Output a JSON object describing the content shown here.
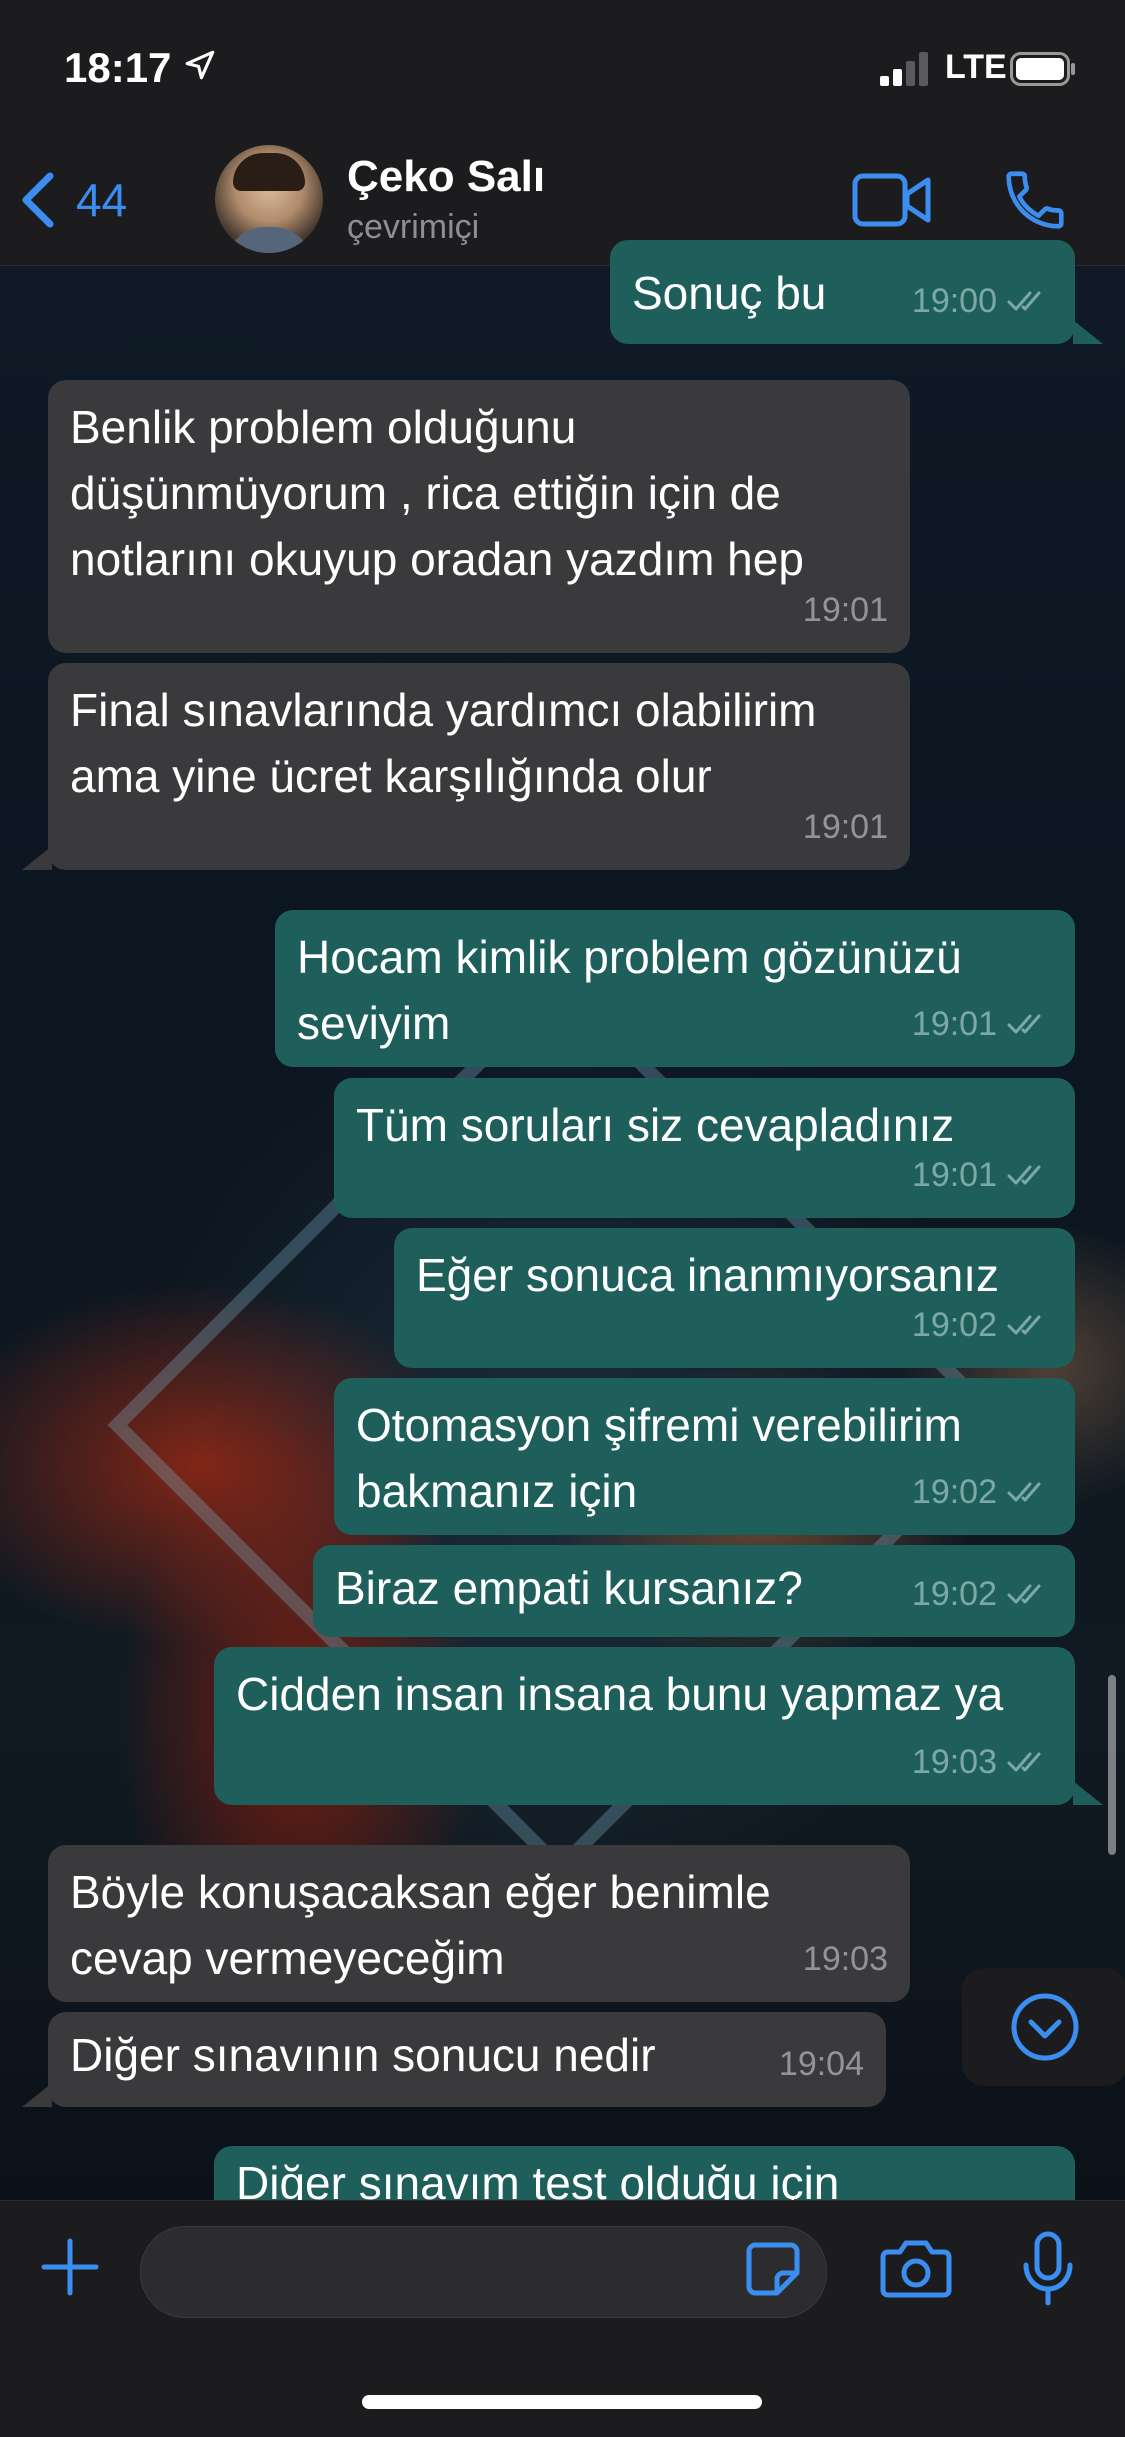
{
  "status_bar": {
    "time": "18:17",
    "network": "LTE"
  },
  "header": {
    "back_count": "44",
    "contact_name": "Çeko Salı",
    "contact_status": "çevrimiçi"
  },
  "colors": {
    "accent": "#3b8ef0",
    "incoming_bubble": "#3a3a3c",
    "outgoing_bubble": "#1f5f5b",
    "bar_background": "#1c1c1e"
  },
  "icons": [
    "location-arrow-icon",
    "signal-icon",
    "battery-icon",
    "chevron-left-icon",
    "video-camera-icon",
    "phone-icon",
    "chevron-down-icon",
    "plus-icon",
    "sticker-icon",
    "camera-icon",
    "microphone-icon",
    "double-check-icon"
  ],
  "messages": [
    {
      "dir": "out",
      "text": "Sonuç bu",
      "time": "19:00"
    },
    {
      "dir": "in",
      "text": "Benlik problem olduğunu düşünmüyorum , rica ettiğin için de notlarını okuyup oradan yazdım hep",
      "time": "19:01"
    },
    {
      "dir": "in",
      "text": "Final sınavlarında yardımcı olabilirim ama yine ücret karşılığında olur",
      "time": "19:01"
    },
    {
      "dir": "out",
      "text": "Hocam kimlik problem gözünüzü seviyim",
      "time": "19:01"
    },
    {
      "dir": "out",
      "text": "Tüm soruları siz cevapladınız",
      "time": "19:01"
    },
    {
      "dir": "out",
      "text": "Eğer sonuca inanmıyorsanız",
      "time": "19:02"
    },
    {
      "dir": "out",
      "text": "Otomasyon şifremi verebilirim bakmanız için",
      "time": "19:02"
    },
    {
      "dir": "out",
      "text": "Biraz empati kursanız?",
      "time": "19:02"
    },
    {
      "dir": "out",
      "text": "Cidden insan insana bunu yapmaz ya",
      "time": "19:03"
    },
    {
      "dir": "in",
      "text": "Böyle konuşacaksan eğer benimle cevap vermeyeceğim",
      "time": "19:03"
    },
    {
      "dir": "in",
      "text": "Diğer sınavının sonucu nedir",
      "time": "19:04"
    },
    {
      "dir": "out",
      "text": "Diğer sınavım test olduğu için",
      "time": ""
    }
  ]
}
